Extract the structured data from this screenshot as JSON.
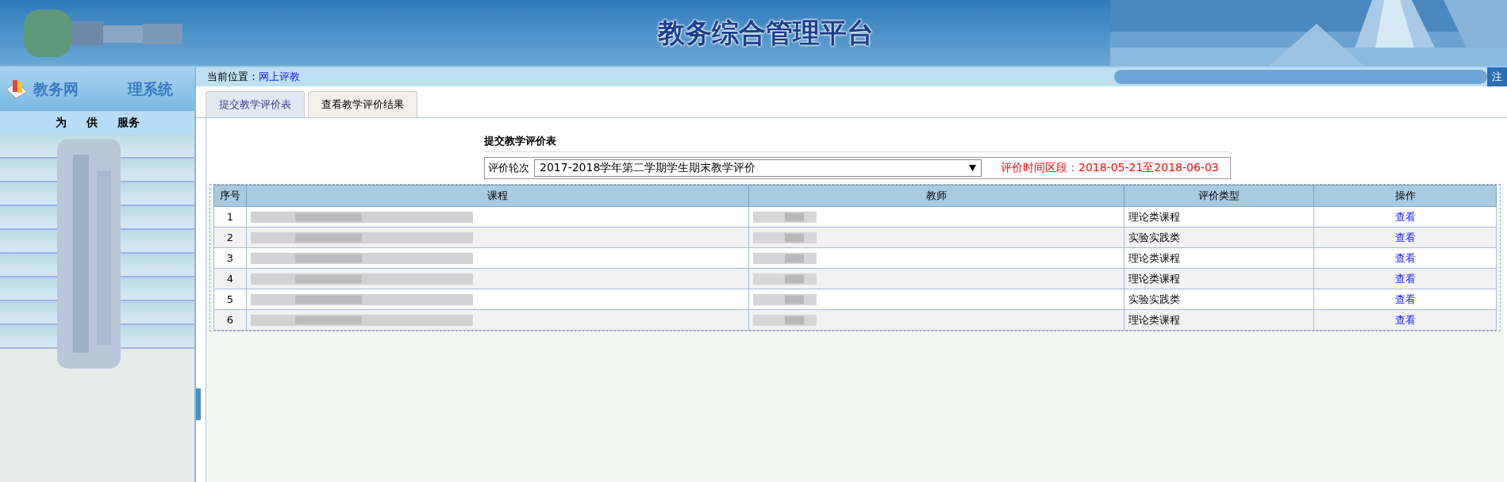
{
  "header": {
    "title": "教务综合管理平台"
  },
  "sidebar": {
    "title_parts": [
      "教务网",
      "理系统"
    ],
    "header_parts": [
      "为",
      "供",
      "服务"
    ]
  },
  "breadcrumb": {
    "label": "当前位置：",
    "link": "网上评教"
  },
  "user_bar": {
    "text": "注"
  },
  "tabs": [
    {
      "label": "提交教学评价表",
      "selected": true
    },
    {
      "label": "查看教学评价结果",
      "selected": false
    }
  ],
  "form": {
    "title": "提交教学评价表",
    "round_label": "评价轮次",
    "round_value": "2017-2018学年第二学期学生期末教学评价",
    "period": "评价时间区段：2018-05-21至2018-06-03"
  },
  "table": {
    "columns": [
      "序号",
      "课程",
      "教师",
      "评价类型",
      "操作"
    ],
    "rows": [
      {
        "index": "1",
        "type": "理论类课程",
        "action": "查看"
      },
      {
        "index": "2",
        "type": "实验实践类",
        "action": "查看"
      },
      {
        "index": "3",
        "type": "理论类课程",
        "action": "查看"
      },
      {
        "index": "4",
        "type": "理论类课程",
        "action": "查看"
      },
      {
        "index": "5",
        "type": "实验实践类",
        "action": "查看"
      },
      {
        "index": "6",
        "type": "理论类课程",
        "action": "查看"
      }
    ]
  }
}
